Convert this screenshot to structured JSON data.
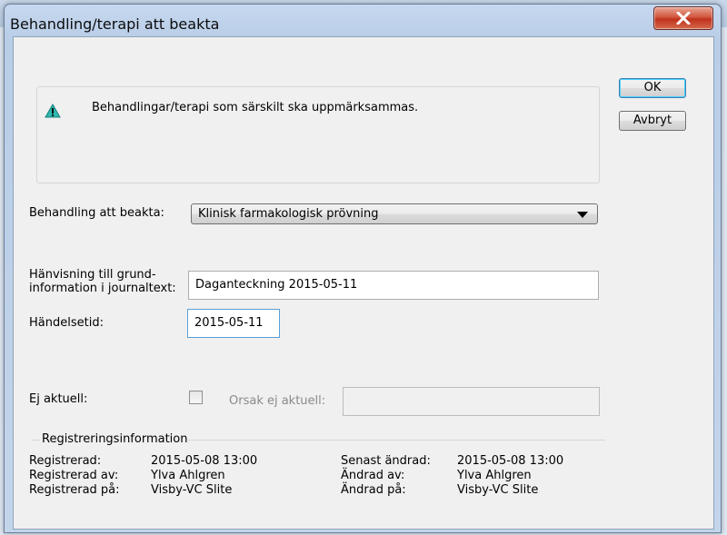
{
  "window": {
    "title": "Behandling/terapi att beakta"
  },
  "info": {
    "text": "Behandlingar/terapi som särskilt ska uppmärksammas."
  },
  "buttons": {
    "ok": "OK",
    "cancel": "Avbryt"
  },
  "form": {
    "treatment_label": "Behandling att beakta:",
    "treatment_value": "Klinisk farmakologisk prövning",
    "reference_label_line1": "Hänvisning till grund-",
    "reference_label_line2": "information i journaltext:",
    "reference_value": "Daganteckning 2015-05-11",
    "event_time_label": "Händelsetid:",
    "event_time_value": "2015-05-11",
    "not_current_label": "Ej aktuell:",
    "not_current_checked": false,
    "reason_label": "Orsak ej aktuell:",
    "reason_value": ""
  },
  "registration": {
    "group_label": "Registreringsinformation",
    "registered_label": "Registrerad:",
    "registered_value": "2015-05-08 13:00",
    "registered_by_label": "Registrerad av:",
    "registered_by_value": "Ylva Ahlgren",
    "registered_at_label": "Registrerad på:",
    "registered_at_value": "Visby-VC Slite",
    "last_changed_label": "Senast ändrad:",
    "last_changed_value": "2015-05-08 13:00",
    "changed_by_label": "Ändrad av:",
    "changed_by_value": "Ylva Ahlgren",
    "changed_at_label": "Ändrad på:",
    "changed_at_value": "Visby-VC Slite"
  },
  "icons": {
    "warning": "warning-icon",
    "dropdown": "chevron-down-icon",
    "close": "close-icon"
  },
  "colors": {
    "close_button": "#c7462f",
    "warning": "#2fb7b0",
    "dialog_bg": "#f0f0f0"
  }
}
